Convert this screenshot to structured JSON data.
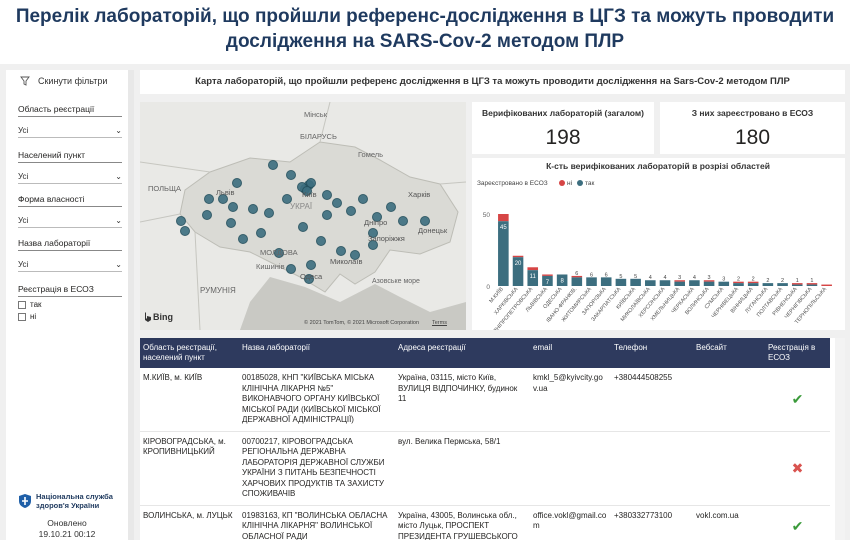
{
  "page_title": "Перелік лабораторій, що пройшли референс-дослідження в ЦГЗ та можуть проводити дослідження на SARS-Cov-2 методом ПЛР",
  "sidebar": {
    "reset_label": "Скинути фільтри",
    "filters": [
      {
        "label": "Область реєстрації",
        "value": "Усі"
      },
      {
        "label": "Населений пункт",
        "value": "Усі"
      },
      {
        "label": "Форма власності",
        "value": "Усі"
      },
      {
        "label": "Назва лабораторії",
        "value": "Усі"
      }
    ],
    "registration_filter": {
      "label": "Реєстрація в ЕСОЗ",
      "options": [
        "так",
        "ні"
      ]
    },
    "logo_text": "Національна служба здоров'я України",
    "updated_label": "Оновлено",
    "updated_value": "19.10.21 00:12"
  },
  "main_title": "Карта лабораторій, що пройшли референс дослідження в ЦГЗ та можуть проводити дослідження на Sars-Cov-2 методом ПЛР",
  "map": {
    "labels": [
      "ПОЛЬЩА",
      "БІЛАРУСЬ",
      "Мінськ",
      "Гомель",
      "Львів",
      "Київ",
      "Харків",
      "Дніпро",
      "Запоріжжя",
      "Миколаїв",
      "Одеса",
      "МОЛДОВА",
      "Кишинів",
      "РУМУНІЯ",
      "Азовське море",
      "Донецьк",
      "УКРАЇ"
    ],
    "attribution": "© 2021 TomTom, © 2021 Microsoft Corporation",
    "terms": "Terms",
    "bing": "Bing"
  },
  "kpi": {
    "verified_label": "Верифікованих лабораторій (загалом)",
    "verified_value": "198",
    "registered_label": "З них зареєстровано в ЕСОЗ",
    "registered_value": "180"
  },
  "chart_data": {
    "type": "bar",
    "title": "К-сть верифікованих лабораторій в розрізі областей",
    "legend_title": "Зареєстровано в ЕСОЗ",
    "legend_placement": "top-left",
    "colors": {
      "ні": "#d64545",
      "так": "#3c6e7f"
    },
    "ylim": [
      0,
      50
    ],
    "yticks": [
      0,
      50
    ],
    "categories": [
      "М.КИЇВ",
      "ХАРКІВСЬКА",
      "ДНІПРОПЕТРОВСЬКА",
      "ЛЬВІВСЬКА",
      "ОДЕСЬКА",
      "ІВАНО-ФРАНКІВ.",
      "ЖИТОМИРСЬКА",
      "ЗАПОРІЗЬКА",
      "ЗАКАРПАТСЬКА",
      "КИЇВСЬКА",
      "МИКОЛАЇВСЬКА",
      "ХЕРСОНСЬКА",
      "ХМЕЛЬНИЦЬКА",
      "ЧЕРКАСЬКА",
      "ВОЛИНСЬКА",
      "СУМСЬКА",
      "ЧЕРНІВЕЦЬКА",
      "ВІННИЦЬКА",
      "ЛУГАНСЬКА",
      "ПОЛТАВСЬКА",
      "РІВНЕНСЬКА",
      "ЧЕРНІГІВСЬКА",
      "ТЕРНОПІЛЬСЬКА"
    ],
    "series": [
      {
        "name": "ні",
        "values": [
          5,
          1,
          2,
          1,
          0,
          1,
          0,
          0,
          0,
          0,
          0,
          0,
          1,
          0,
          1,
          0,
          1,
          1,
          0,
          0,
          1,
          1,
          1
        ]
      },
      {
        "name": "так",
        "values": [
          45,
          20,
          11,
          7,
          8,
          6,
          6,
          6,
          5,
          5,
          4,
          4,
          3,
          4,
          3,
          3,
          2,
          2,
          2,
          2,
          1,
          1,
          0
        ]
      }
    ],
    "data_labels": [
      "45",
      "20",
      "11",
      "7",
      "8",
      "6",
      "6",
      "6",
      "5",
      "5",
      "4",
      "4",
      "3",
      "4",
      "3",
      "3",
      "2",
      "2",
      "2",
      "2",
      "1",
      "1"
    ]
  },
  "table": {
    "headers": [
      "Область реєстрації, населений пункт",
      "Назва лабораторії",
      "Адреса реєстрації",
      "email",
      "Телефон",
      "Вебсайт",
      "Реєстрація в ЕСОЗ"
    ],
    "rows": [
      {
        "region": "М.КИЇВ, м. КИЇВ",
        "name": "00185028, КНП \"КИЇВСЬКА МІСЬКА КЛІНІЧНА ЛІКАРНЯ №5\" ВИКОНАВЧОГО ОРГАНУ КИЇВСЬКОЇ МІСЬКОЇ РАДИ (КИЇВСЬКОЇ МІСЬКОЇ ДЕРЖАВНОЇ АДМІНІСТРАЦІЇ)",
        "address": "Україна, 03115, місто Київ, ВУЛИЦЯ ВІДПОЧИНКУ, будинок 11",
        "email": "kmkl_5@kyivcity.gov.ua",
        "phone": "+380444508255",
        "site": "",
        "reg": "✔"
      },
      {
        "region": "КІРОВОГРАДСЬКА, м. КРОПИВНИЦЬКИЙ",
        "name": "00700217, КІРОВОГРАДСЬКА РЕГІОНАЛЬНА ДЕРЖАВНА ЛАБОРАТОРІЯ ДЕРЖАВНОЇ СЛУЖБИ УКРАЇНИ З ПИТАНЬ БЕЗПЕЧНОСТІ ХАРЧОВИХ ПРОДУКТІВ ТА ЗАХИСТУ СПОЖИВАЧІВ",
        "address": "вул. Велика Пермська, 58/1",
        "email": "",
        "phone": "",
        "site": "",
        "reg": "✖"
      },
      {
        "region": "ВОЛИНСЬКА, м. ЛУЦЬК",
        "name": "01983163, КП \"ВОЛИНСЬКА ОБЛАСНА КЛІНІЧНА ЛІКАРНЯ\" ВОЛИНСЬКОЇ ОБЛАСНОЇ РАДИ",
        "address": "Україна, 43005, Волинська обл., місто Луцьк, ПРОСПЕКТ ПРЕЗИДЕНТА ГРУШЕВСЬКОГО",
        "email": "office.vokl@gmail.com",
        "phone": "+380332773100",
        "site": "vokl.com.ua",
        "reg": "✔"
      }
    ]
  }
}
